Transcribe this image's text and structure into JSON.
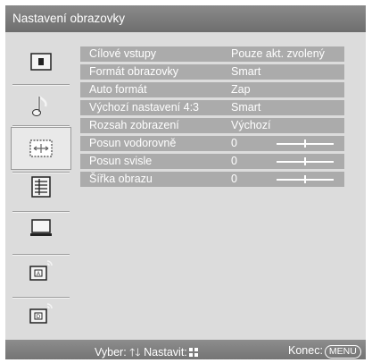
{
  "window": {
    "title": "Nastavení obrazovky"
  },
  "menu": {
    "rows": [
      {
        "label": "Cílové vstupy",
        "value": "Pouze akt. zvolený"
      },
      {
        "label": "Formát obrazovky",
        "value": "Smart"
      },
      {
        "label": "Auto formát",
        "value": "Zap"
      },
      {
        "label": "Výchozí nastavení 4:3",
        "value": "Smart"
      },
      {
        "label": "Rozsah zobrazení",
        "value": "Výchozí"
      },
      {
        "label": "Posun vodorovně",
        "value": "0",
        "slider_level": 0.5
      },
      {
        "label": "Posun svisle",
        "value": "0",
        "slider_level": 0.5
      },
      {
        "label": "Šířka obrazu",
        "value": "0",
        "slider_level": 0.5
      }
    ]
  },
  "sidebar": {
    "items": [
      {
        "icon": "picture-icon"
      },
      {
        "icon": "music-note-icon"
      },
      {
        "icon": "screen-adjust-icon",
        "selected": true
      },
      {
        "icon": "list-settings-icon"
      },
      {
        "icon": "pc-screen-icon"
      },
      {
        "icon": "analog-broadcast-icon"
      },
      {
        "icon": "digital-broadcast-icon"
      }
    ]
  },
  "footer": {
    "select_label": "Vyber:",
    "set_label": "Nastavit:",
    "exit_label": "Konec:",
    "menu_button": "MENU"
  }
}
